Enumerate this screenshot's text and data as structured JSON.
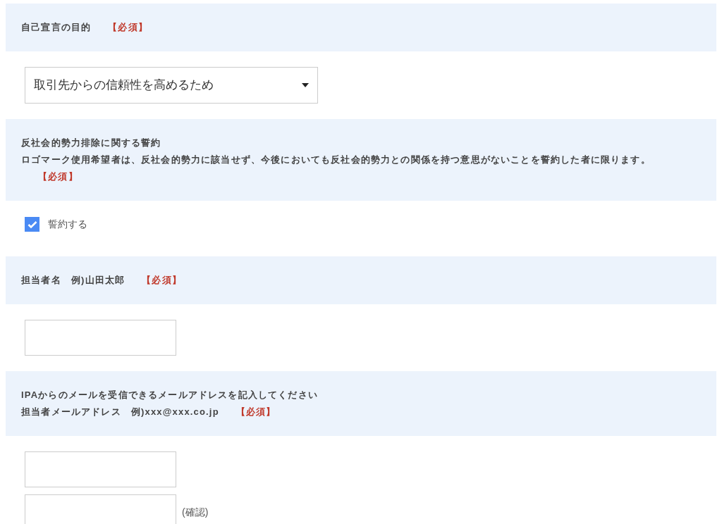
{
  "sections": [
    {
      "header": {
        "lines": [
          "自己宣言の目的"
        ],
        "required_label": "【必須】"
      },
      "field": {
        "kind": "select",
        "value": "取引先からの信頼性を高めるため"
      }
    },
    {
      "header": {
        "lines": [
          "反社会的勢力排除に関する誓約",
          "ロゴマーク使用希望者は、反社会的勢力に該当せず、今後においても反社会的勢力との関係を持つ意思がないことを誓約した者に限ります。"
        ],
        "required_label": "【必須】"
      },
      "field": {
        "kind": "checkbox",
        "label": "誓約する",
        "checked": true
      }
    },
    {
      "header": {
        "lines": [
          "担当者名　例)山田太郎"
        ],
        "required_label": "【必須】"
      },
      "field": {
        "kind": "text"
      }
    },
    {
      "header": {
        "lines": [
          "IPAからのメールを受信できるメールアドレスを記入してください",
          "担当者メールアドレス　例)xxx@xxx.co.jp"
        ],
        "required_label": "【必須】"
      },
      "field": {
        "kind": "email",
        "confirm_label": "(確認)"
      }
    }
  ]
}
